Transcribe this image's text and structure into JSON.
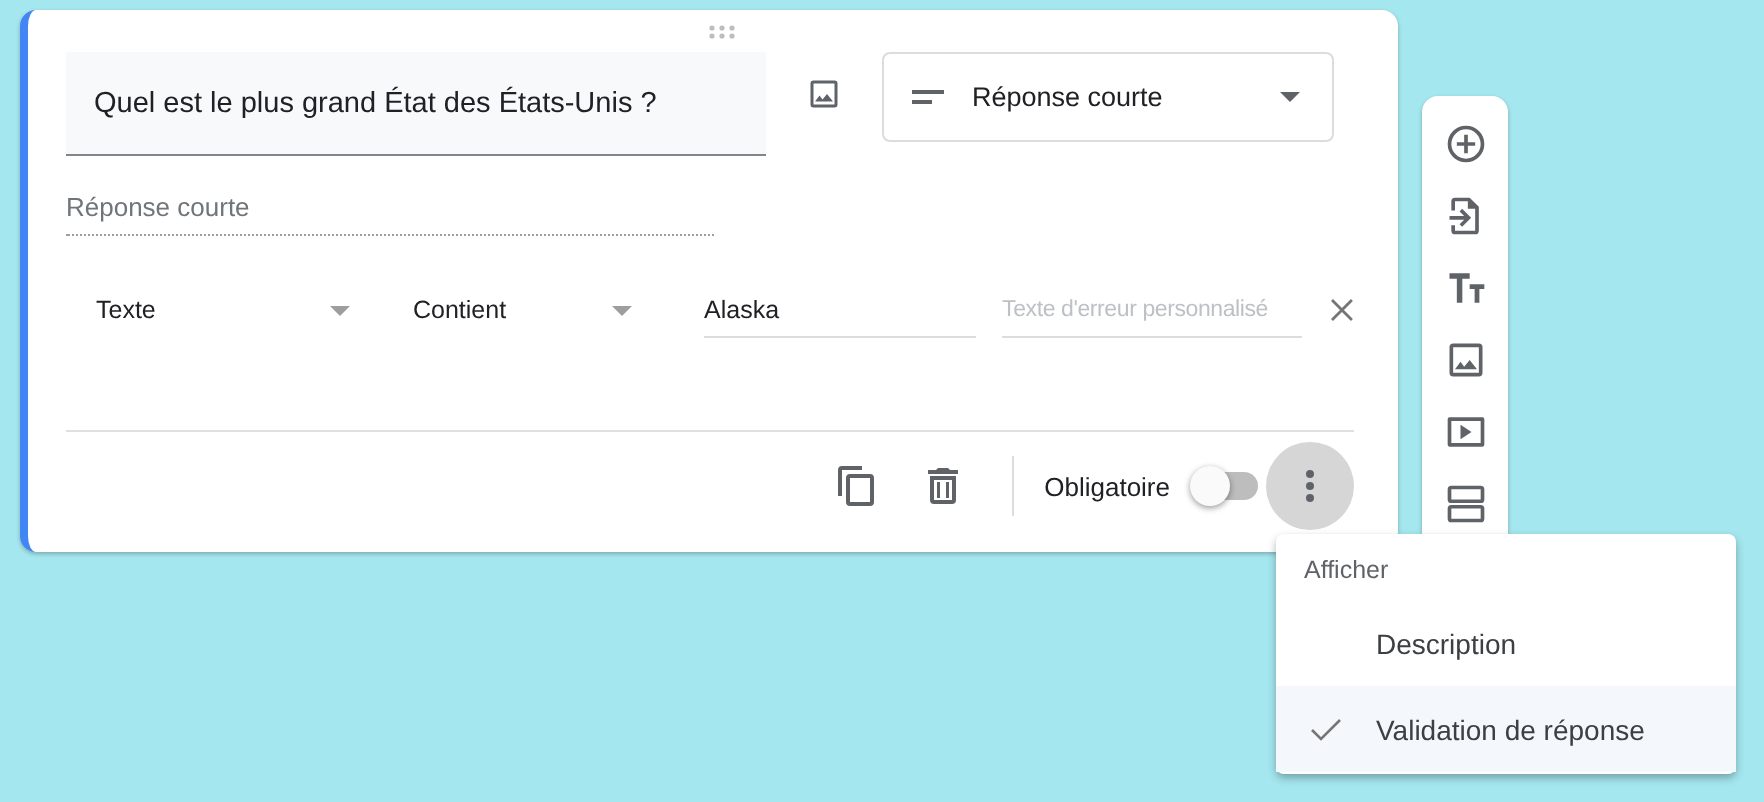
{
  "question": {
    "title": "Quel est le plus grand État des États-Unis ?",
    "type": "Réponse courte",
    "answer_placeholder": "Réponse courte"
  },
  "validation": {
    "type": "Texte",
    "condition": "Contient",
    "value": "Alaska",
    "error_placeholder": "Texte d'erreur personnalisé"
  },
  "footer": {
    "required_label": "Obligatoire",
    "required": false
  },
  "toolbar": [
    {
      "kind": "add"
    },
    {
      "kind": "import"
    },
    {
      "kind": "title"
    },
    {
      "kind": "image"
    },
    {
      "kind": "video"
    },
    {
      "kind": "section"
    }
  ],
  "menu": {
    "header": "Afficher",
    "items": [
      {
        "label": "Description",
        "checked": false
      },
      {
        "label": "Validation de réponse",
        "checked": true
      }
    ]
  }
}
